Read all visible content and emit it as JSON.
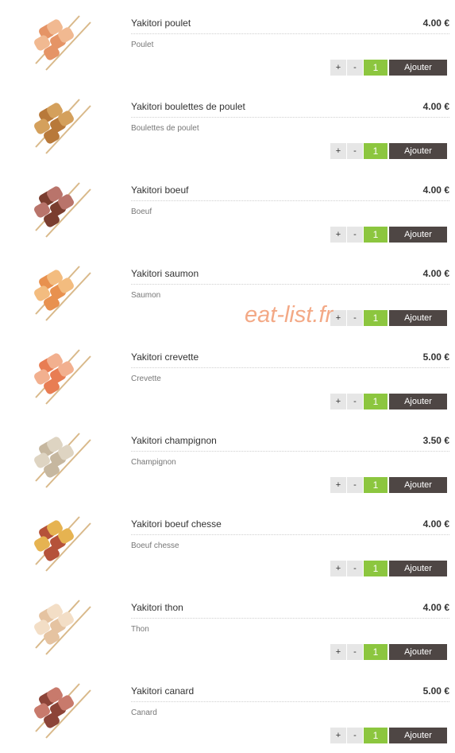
{
  "watermark": "eat-list.fr",
  "items": [
    {
      "name": "Yakitori poulet",
      "price": "4.00 €",
      "desc": "Poulet",
      "qty": "1",
      "add": "Ajouter",
      "plus": "+",
      "minus": "-",
      "image": "chicken-skewer",
      "colors": [
        "#e59466",
        "#f1b991"
      ]
    },
    {
      "name": "Yakitori boulettes de poulet",
      "price": "4.00 €",
      "desc": "Boulettes de poulet",
      "qty": "1",
      "add": "Ajouter",
      "plus": "+",
      "minus": "-",
      "image": "meatball-skewer",
      "colors": [
        "#b8793a",
        "#d4a05c"
      ]
    },
    {
      "name": "Yakitori boeuf",
      "price": "4.00 €",
      "desc": "Boeuf",
      "qty": "1",
      "add": "Ajouter",
      "plus": "+",
      "minus": "-",
      "image": "beef-skewer",
      "colors": [
        "#7a3d2f",
        "#b9746b"
      ]
    },
    {
      "name": "Yakitori saumon",
      "price": "4.00 €",
      "desc": "Saumon",
      "qty": "1",
      "add": "Ajouter",
      "plus": "+",
      "minus": "-",
      "image": "salmon-skewer",
      "colors": [
        "#e8914f",
        "#f3bc7f"
      ]
    },
    {
      "name": "Yakitori crevette",
      "price": "5.00 €",
      "desc": "Crevette",
      "qty": "1",
      "add": "Ajouter",
      "plus": "+",
      "minus": "-",
      "image": "shrimp-skewer",
      "colors": [
        "#e87d53",
        "#f2b08f"
      ]
    },
    {
      "name": "Yakitori champignon",
      "price": "3.50 €",
      "desc": "Champignon",
      "qty": "1",
      "add": "Ajouter",
      "plus": "+",
      "minus": "-",
      "image": "mushroom-skewer",
      "colors": [
        "#c6b79f",
        "#ded4c2"
      ]
    },
    {
      "name": "Yakitori boeuf chesse",
      "price": "4.00 €",
      "desc": "Boeuf chesse",
      "qty": "1",
      "add": "Ajouter",
      "plus": "+",
      "minus": "-",
      "image": "beef-cheese-skewer",
      "colors": [
        "#b5523a",
        "#e6b351"
      ]
    },
    {
      "name": "Yakitori thon",
      "price": "4.00 €",
      "desc": "Thon",
      "qty": "1",
      "add": "Ajouter",
      "plus": "+",
      "minus": "-",
      "image": "tuna-skewer",
      "colors": [
        "#e5c3a1",
        "#f3dec6"
      ]
    },
    {
      "name": "Yakitori canard",
      "price": "5.00 €",
      "desc": "Canard",
      "qty": "1",
      "add": "Ajouter",
      "plus": "+",
      "minus": "-",
      "image": "duck-skewer",
      "colors": [
        "#8c4438",
        "#c87a6c"
      ]
    }
  ]
}
